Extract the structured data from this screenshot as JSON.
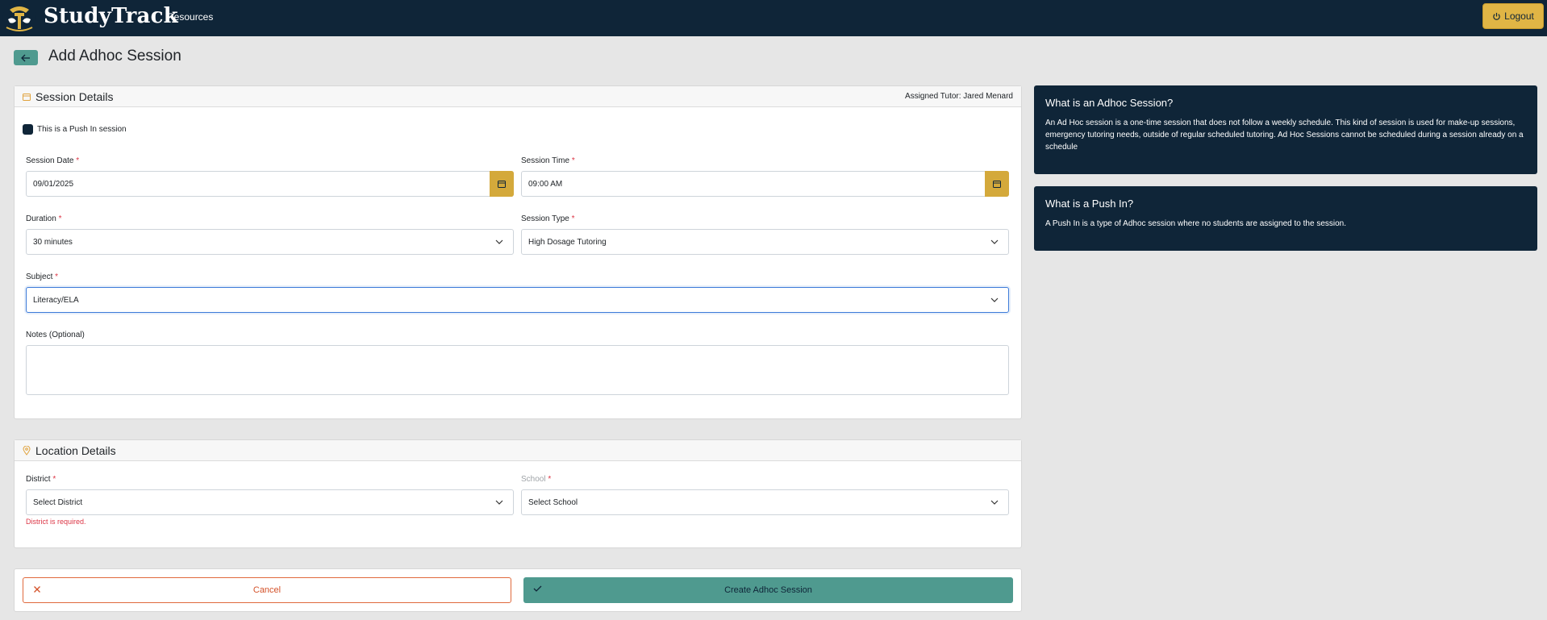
{
  "app": {
    "brand": "StudyTrack",
    "nav_resources": "Resources",
    "logout_label": "Logout"
  },
  "header": {
    "title": "Add Adhoc Session"
  },
  "session_details": {
    "title": "Session Details",
    "assigned_tutor": "Assigned Tutor: Jared Menard",
    "push_in_label": "This is a Push In session",
    "session_date_label": "Session Date",
    "session_date_value": "09/01/2025",
    "session_time_label": "Session Time",
    "session_time_value": "09:00 AM",
    "duration_label": "Duration",
    "duration_value": "30 minutes",
    "session_type_label": "Session Type",
    "session_type_value": "High Dosage Tutoring",
    "subject_label": "Subject",
    "subject_value": "Literacy/ELA",
    "notes_label": "Notes (Optional)",
    "notes_value": "",
    "required_mark": "*"
  },
  "location_details": {
    "title": "Location Details",
    "district_label": "District",
    "district_value": "Select District",
    "district_error": "District is required.",
    "school_label": "School",
    "school_value": "Select School",
    "required_mark": "*"
  },
  "actions": {
    "cancel_label": "Cancel",
    "create_label": "Create Adhoc Session"
  },
  "info": {
    "adhoc_title": "What is an Adhoc Session?",
    "adhoc_text": "An Ad Hoc session is a one-time session that does not follow a weekly schedule. This kind of session is used for make-up sessions, emergency tutoring needs, outside of regular scheduled tutoring. Ad Hoc Sessions cannot be scheduled during a session already on a schedule",
    "pushin_title": "What is a Push In?",
    "pushin_text": "A Push In is a type of Adhoc session where no students are assigned to the session."
  },
  "colors": {
    "navy": "#0f2538",
    "gold": "#e0b545",
    "teal": "#4f9a8f",
    "error": "#dc3545"
  }
}
